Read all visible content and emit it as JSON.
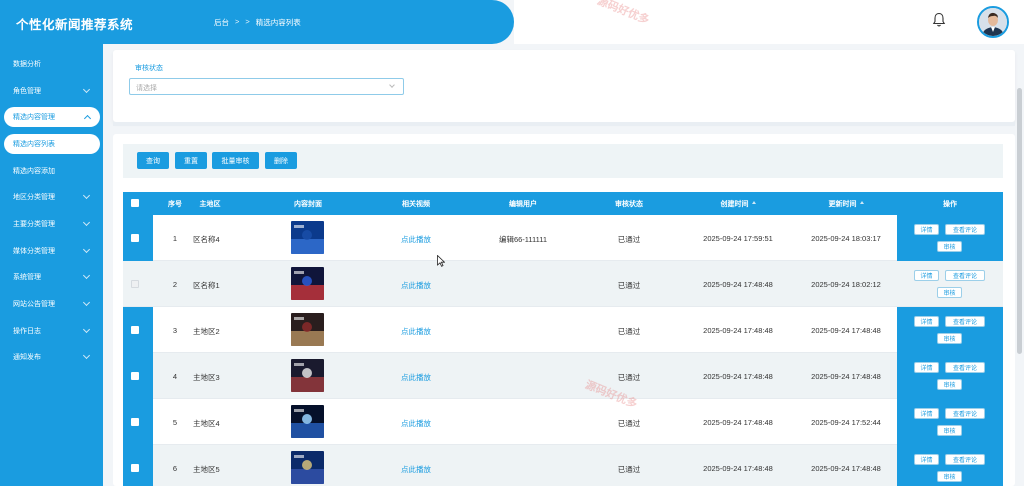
{
  "app": {
    "title": "个性化新闻推荐系统"
  },
  "breadcrumb": {
    "home": "后台",
    "sep1": ">",
    "sep2": ">",
    "current": "精选内容列表"
  },
  "sidebar": {
    "items": [
      {
        "label": "数据分析",
        "chevron": false
      },
      {
        "label": "角色管理",
        "chevron": true
      },
      {
        "label": "精选内容管理",
        "chevron": true,
        "expanded": true
      },
      {
        "label": "精选内容列表",
        "sub": true,
        "active": true
      },
      {
        "label": "精选内容添加",
        "sub": true
      },
      {
        "label": "地区分类管理",
        "chevron": true
      },
      {
        "label": "主要分类管理",
        "chevron": true
      },
      {
        "label": "媒体分类管理",
        "chevron": true
      },
      {
        "label": "系统管理",
        "chevron": true
      },
      {
        "label": "网站公告管理",
        "chevron": true
      },
      {
        "label": "操作日志",
        "chevron": true
      },
      {
        "label": "通知发布",
        "chevron": true
      }
    ]
  },
  "search": {
    "label": "审核状态",
    "placeholder": "请选择"
  },
  "toolbar": {
    "query": "查询",
    "reset": "重置",
    "batch_review": "批量审核",
    "delete": "删除"
  },
  "table": {
    "headers": {
      "index": "序号",
      "region": "主地区",
      "cover": "内容封面",
      "video": "相关视频",
      "editor": "编辑用户",
      "status": "审核状态",
      "created": "创建时间",
      "updated": "更新时间",
      "ops": "操作"
    },
    "rows": [
      {
        "index": "1",
        "region": "区名称4",
        "video": "点此播放",
        "editor": "编辑66-111111",
        "status": "已通过",
        "created": "2025-09-24 17:59:51",
        "updated": "2025-09-24 18:03:17"
      },
      {
        "index": "2",
        "region": "区名称1",
        "video": "点此播放",
        "editor": "",
        "status": "已通过",
        "created": "2025-09-24 17:48:48",
        "updated": "2025-09-24 18:02:12"
      },
      {
        "index": "3",
        "region": "主地区2",
        "video": "点此播放",
        "editor": "",
        "status": "已通过",
        "created": "2025-09-24 17:48:48",
        "updated": "2025-09-24 17:48:48"
      },
      {
        "index": "4",
        "region": "主地区3",
        "video": "点此播放",
        "editor": "",
        "status": "已通过",
        "created": "2025-09-24 17:48:48",
        "updated": "2025-09-24 17:48:48"
      },
      {
        "index": "5",
        "region": "主地区4",
        "video": "点此播放",
        "editor": "",
        "status": "已通过",
        "created": "2025-09-24 17:48:48",
        "updated": "2025-09-24 17:52:44"
      },
      {
        "index": "6",
        "region": "主地区5",
        "video": "点此播放",
        "editor": "",
        "status": "已通过",
        "created": "2025-09-24 17:48:48",
        "updated": "2025-09-24 17:48:48"
      }
    ],
    "row_actions": {
      "detail": "详情",
      "comments": "查看评论",
      "review": "审核"
    }
  },
  "watermark": "源码好优多",
  "colors": {
    "primary": "#1a9ce0",
    "alt_row": "#eef3f5"
  },
  "icons": {
    "bell": "bell-icon",
    "avatar": "user-avatar",
    "chevron": "chevron-down-icon",
    "sort": "sort-icon"
  }
}
